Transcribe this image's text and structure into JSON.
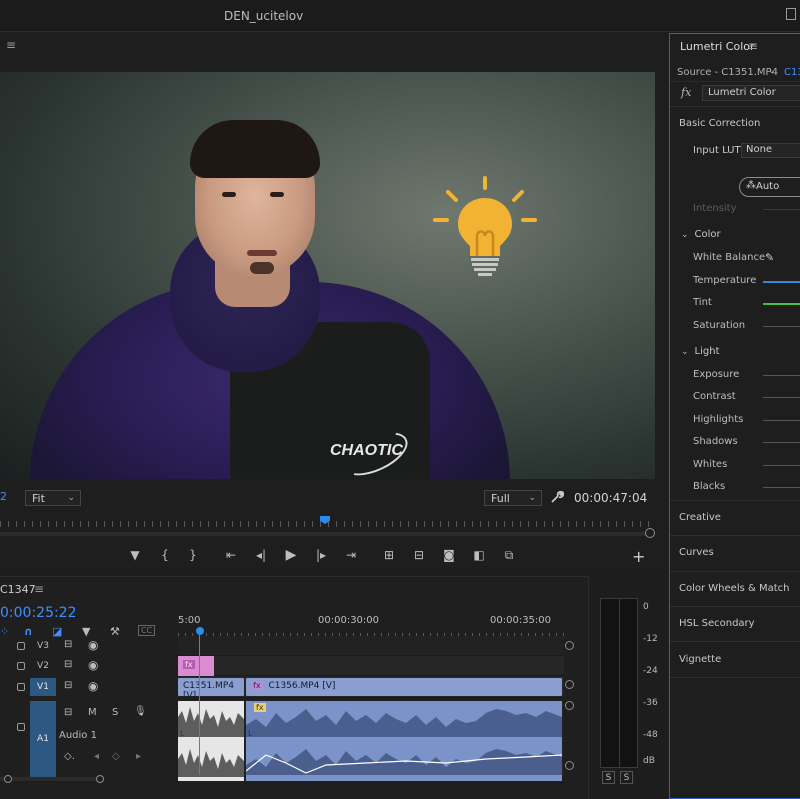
{
  "app": {
    "title": "DEN_ucitelov"
  },
  "program_monitor": {
    "zoom_value_partial": "2",
    "fit_select": "Fit",
    "resolution_select": "Full",
    "duration": "00:00:47:04",
    "hoodie_text": "CHAOTIC"
  },
  "timeline": {
    "sequence_name": "C1347",
    "timecode": "0:00:25:22",
    "ruler": {
      "left_partial": "5:00",
      "mid": "00:00:30:00",
      "right": "00:00:35:00"
    },
    "tracks": {
      "v3": "V3",
      "v2": "V2",
      "v1": "V1",
      "a1": "A1",
      "a1_name": "Audio 1",
      "a1_m": "M",
      "a1_s": "S"
    },
    "clips": {
      "v3_fx": "fx",
      "v1_clip1": "C1351.MP4 [V]",
      "v1_clip2_fx": "fx",
      "v1_clip2": "C1356.MP4 [V]",
      "a1_fx": "fx",
      "a1_label": "L"
    },
    "tools": {
      "cc": "CC"
    }
  },
  "audio_meter": {
    "scale": [
      "0",
      "-12",
      "-24",
      "-36",
      "-48",
      "dB"
    ],
    "solo_left": "S",
    "solo_right": "S"
  },
  "lumetri": {
    "title": "Lumetri Color",
    "source": "Source - C1351.MP4",
    "sequence_partial": "C13",
    "fx_label": "fx",
    "effect": "Lumetri Color",
    "basic_correction": "Basic Correction",
    "input_lut_label": "Input LUT",
    "input_lut_value": "None",
    "auto_button": "Auto",
    "intensity": "Intensity",
    "color_section": "Color",
    "white_balance": "White Balance",
    "temperature": "Temperature",
    "tint": "Tint",
    "saturation": "Saturation",
    "light_section": "Light",
    "exposure": "Exposure",
    "contrast": "Contrast",
    "highlights": "Highlights",
    "shadows": "Shadows",
    "whites": "Whites",
    "blacks": "Blacks",
    "creative": "Creative",
    "curves": "Curves",
    "color_wheels": "Color Wheels & Match",
    "hsl_secondary": "HSL Secondary",
    "vignette": "Vignette"
  },
  "colors": {
    "accent_blue": "#3d8fff",
    "temperature_slider": "#2f8ad8",
    "tint_slider": "#3fbf4a",
    "clip_video": "#8a9fd0",
    "clip_pink": "#d98cd2",
    "clip_audio": "#7b93c8",
    "bulb_yellow": "#f2b233"
  }
}
